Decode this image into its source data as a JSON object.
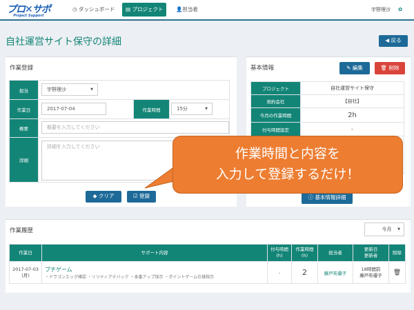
{
  "nav": {
    "logo": "プロ✕サポ",
    "logo_sub": "Project Support",
    "items": [
      "ダッシュボード",
      "プロジェクト",
      "担当者"
    ],
    "user": "宇野理沙"
  },
  "page": {
    "title": "自社運営サイト保守の詳細",
    "back": "戻る"
  },
  "work_form": {
    "title": "作業登録",
    "labels": {
      "assignee": "担当",
      "date": "作業日",
      "time": "作業時間",
      "summary": "概要",
      "detail": "詳細"
    },
    "assignee": "宇野理沙",
    "date": "2017-07-04",
    "time": "15分",
    "summary_placeholder": "概要を入力してください",
    "detail_placeholder": "詳細を入力してください",
    "clear": "クリア",
    "register": "登録"
  },
  "basic": {
    "title": "基本情報",
    "edit": "編集",
    "delete": "削除",
    "rows": [
      {
        "label": "プロジェクト",
        "value": "自社運営サイト保守"
      },
      {
        "label": "契約会社",
        "value": "【自社】"
      },
      {
        "label": "今月の作業時間",
        "value": "2h"
      },
      {
        "label": "付与時間設定",
        "value": "-"
      }
    ],
    "detail_button": "基本情報詳細"
  },
  "callout": {
    "line1": "作業時間と内容を",
    "line2": "入力して登録するだけ！"
  },
  "history": {
    "title": "作業履歴",
    "filter": "今月",
    "headers": [
      "作業日",
      "サポート内容",
      "付与時間\n(h)",
      "作業時間\n(h)",
      "担当者",
      "更新日\n更新者",
      "削除"
    ],
    "rows": [
      {
        "date": "2017-07-03",
        "weekday": "(月)",
        "title": "プチゲーム",
        "desc": "・ドラゴンエッグ確認 ・ソリティアデバック ・本番アップ指示 ・ポイントゲーム仕様指示",
        "granted": "-",
        "hours": "2",
        "assignee": "藤戸布優子",
        "updated": "18時間前",
        "updater": "藤戸布優子"
      }
    ]
  },
  "colors": {
    "accent": "#138577",
    "primary": "#1d6a98",
    "danger": "#d9443a",
    "callout": "#ed7d31"
  }
}
